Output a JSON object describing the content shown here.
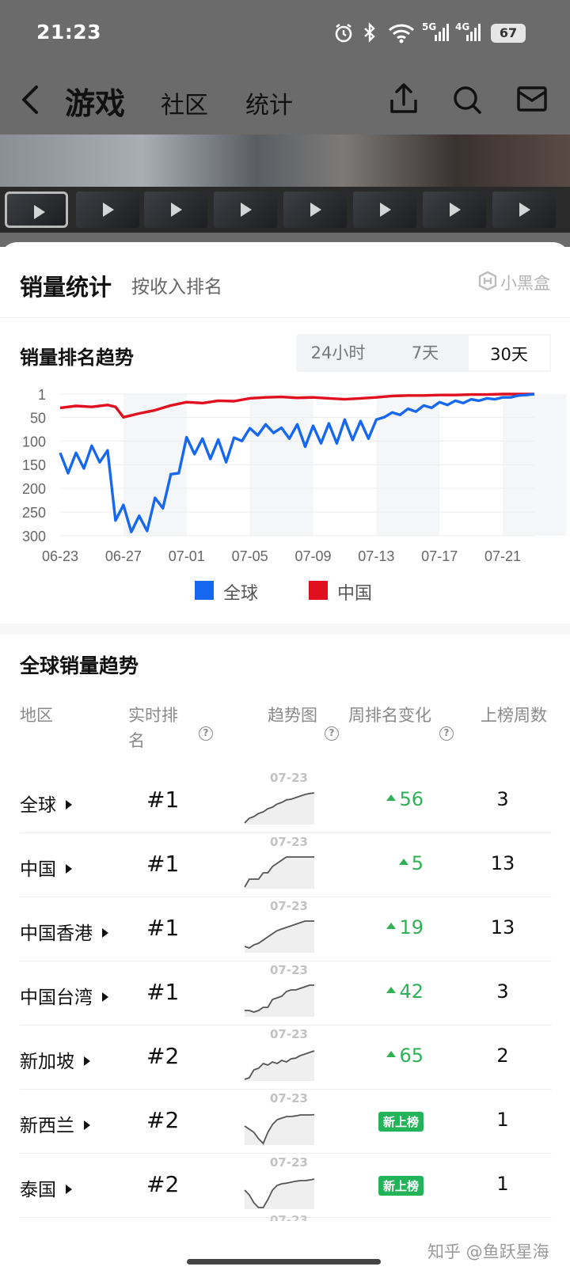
{
  "status_bar": {
    "time": "21:23",
    "signal_5g": "5G",
    "signal_4g": "4G",
    "battery": "67"
  },
  "nav": {
    "title": "游戏",
    "tabs": [
      "社区",
      "统计"
    ]
  },
  "section": {
    "title": "销量统计",
    "subtitle": "按收入排名",
    "brand": "小黑盒"
  },
  "trend": {
    "title": "销量排名趋势",
    "ranges": [
      "24小时",
      "7天",
      "30天"
    ],
    "selected_range": "30天"
  },
  "chart_data": {
    "type": "line",
    "yaxis_reversed": true,
    "ylim": [
      300,
      1
    ],
    "yticks": [
      "1",
      "50",
      "100",
      "150",
      "200",
      "250",
      "300"
    ],
    "xticks": [
      "06-23",
      "06-27",
      "07-01",
      "07-05",
      "07-09",
      "07-13",
      "07-17",
      "07-21"
    ],
    "x_start": "06-23",
    "x_end": "07-23",
    "series": [
      {
        "name": "全球",
        "color": "#1668f0",
        "points": [
          [
            0,
            125
          ],
          [
            0.5,
            168
          ],
          [
            1,
            125
          ],
          [
            1.5,
            158
          ],
          [
            2,
            110
          ],
          [
            2.5,
            145
          ],
          [
            3,
            120
          ],
          [
            3.5,
            268
          ],
          [
            4,
            235
          ],
          [
            4.5,
            292
          ],
          [
            5,
            258
          ],
          [
            5.5,
            290
          ],
          [
            6,
            220
          ],
          [
            6.5,
            242
          ],
          [
            7,
            170
          ],
          [
            7.5,
            168
          ],
          [
            8,
            92
          ],
          [
            8.5,
            128
          ],
          [
            9,
            95
          ],
          [
            9.5,
            138
          ],
          [
            10,
            97
          ],
          [
            10.5,
            145
          ],
          [
            11,
            93
          ],
          [
            11.5,
            100
          ],
          [
            12,
            73
          ],
          [
            12.5,
            88
          ],
          [
            13,
            65
          ],
          [
            13.5,
            83
          ],
          [
            14,
            72
          ],
          [
            14.5,
            95
          ],
          [
            15,
            65
          ],
          [
            15.5,
            112
          ],
          [
            16,
            68
          ],
          [
            16.5,
            105
          ],
          [
            17,
            63
          ],
          [
            17.5,
            105
          ],
          [
            18,
            55
          ],
          [
            18.5,
            98
          ],
          [
            19,
            58
          ],
          [
            19.5,
            95
          ],
          [
            20,
            55
          ],
          [
            20.5,
            50
          ],
          [
            21,
            40
          ],
          [
            21.5,
            45
          ],
          [
            22,
            32
          ],
          [
            22.5,
            38
          ],
          [
            23,
            25
          ],
          [
            23.5,
            30
          ],
          [
            24,
            18
          ],
          [
            24.5,
            24
          ],
          [
            25,
            15
          ],
          [
            25.5,
            20
          ],
          [
            26,
            12
          ],
          [
            26.5,
            15
          ],
          [
            27,
            10
          ],
          [
            27.5,
            12
          ],
          [
            28,
            8
          ],
          [
            28.5,
            8
          ],
          [
            29,
            4
          ],
          [
            29.5,
            3
          ],
          [
            30,
            1
          ]
        ]
      },
      {
        "name": "中国",
        "color": "#e0101e",
        "points": [
          [
            0,
            30
          ],
          [
            1,
            26
          ],
          [
            2,
            28
          ],
          [
            3,
            24
          ],
          [
            3.5,
            28
          ],
          [
            4,
            50
          ],
          [
            5,
            42
          ],
          [
            6,
            35
          ],
          [
            7,
            25
          ],
          [
            8,
            18
          ],
          [
            9,
            20
          ],
          [
            10,
            15
          ],
          [
            11,
            16
          ],
          [
            12,
            10
          ],
          [
            13,
            8
          ],
          [
            14,
            7
          ],
          [
            15,
            9
          ],
          [
            16,
            8
          ],
          [
            17,
            10
          ],
          [
            18,
            12
          ],
          [
            19,
            10
          ],
          [
            20,
            8
          ],
          [
            21,
            5
          ],
          [
            22,
            4
          ],
          [
            23,
            4
          ],
          [
            24,
            3
          ],
          [
            25,
            3
          ],
          [
            26,
            2
          ],
          [
            27,
            2
          ],
          [
            28,
            1
          ],
          [
            30,
            1
          ]
        ]
      }
    ]
  },
  "legend": [
    {
      "label": "全球",
      "color": "#1668f0"
    },
    {
      "label": "中国",
      "color": "#e0101e"
    }
  ],
  "global": {
    "title": "全球销量趋势",
    "headers": {
      "region": "地区",
      "rank": "实时排名",
      "spark": "趋势图",
      "change": "周排名变化",
      "weeks": "上榜周数"
    },
    "rows": [
      {
        "region": "全球",
        "rank": "#1",
        "date": "07-23",
        "change": "56",
        "weeks": "3",
        "is_new": false,
        "spark": [
          0.05,
          0.2,
          0.25,
          0.35,
          0.4,
          0.5,
          0.55,
          0.65,
          0.7,
          0.78,
          0.8,
          0.85,
          0.9,
          0.95,
          0.98,
          1.0
        ]
      },
      {
        "region": "中国",
        "rank": "#1",
        "date": "07-23",
        "change": "5",
        "weeks": "13",
        "is_new": false,
        "spark": [
          0.05,
          0.3,
          0.3,
          0.3,
          0.5,
          0.5,
          0.7,
          0.8,
          0.9,
          1.0,
          1.0,
          1.0,
          1.0,
          1.0,
          1.0,
          1.0
        ]
      },
      {
        "region": "中国香港",
        "rank": "#1",
        "date": "07-23",
        "change": "19",
        "weeks": "13",
        "is_new": false,
        "spark": [
          0.2,
          0.15,
          0.25,
          0.3,
          0.4,
          0.5,
          0.6,
          0.7,
          0.75,
          0.8,
          0.85,
          0.9,
          0.95,
          1.0,
          1.0,
          1.0
        ]
      },
      {
        "region": "中国台湾",
        "rank": "#1",
        "date": "07-23",
        "change": "42",
        "weeks": "3",
        "is_new": false,
        "spark": [
          0.2,
          0.2,
          0.15,
          0.2,
          0.3,
          0.3,
          0.55,
          0.6,
          0.65,
          0.8,
          0.85,
          0.85,
          0.9,
          0.95,
          1.0,
          1.0
        ]
      },
      {
        "region": "新加坡",
        "rank": "#2",
        "date": "07-23",
        "change": "65",
        "weeks": "2",
        "is_new": false,
        "spark": [
          0.05,
          0.1,
          0.35,
          0.4,
          0.55,
          0.5,
          0.6,
          0.55,
          0.65,
          0.6,
          0.7,
          0.72,
          0.8,
          0.85,
          0.9,
          0.95
        ]
      },
      {
        "region": "新西兰",
        "rank": "#2",
        "date": "07-23",
        "change": "新上榜",
        "weeks": "1",
        "is_new": true,
        "spark": [
          0.6,
          0.5,
          0.4,
          0.2,
          0.05,
          0.4,
          0.65,
          0.8,
          0.85,
          0.9,
          0.9,
          0.92,
          0.95,
          0.95,
          0.95,
          0.96
        ]
      },
      {
        "region": "泰国",
        "rank": "#2",
        "date": "07-23",
        "change": "新上榜",
        "weeks": "1",
        "is_new": true,
        "spark": [
          0.6,
          0.45,
          0.2,
          0.05,
          0.05,
          0.3,
          0.6,
          0.75,
          0.8,
          0.82,
          0.85,
          0.88,
          0.9,
          0.9,
          0.92,
          0.95
        ]
      }
    ],
    "next_date": "07-23"
  },
  "watermark": "知乎 @鱼跃星海"
}
